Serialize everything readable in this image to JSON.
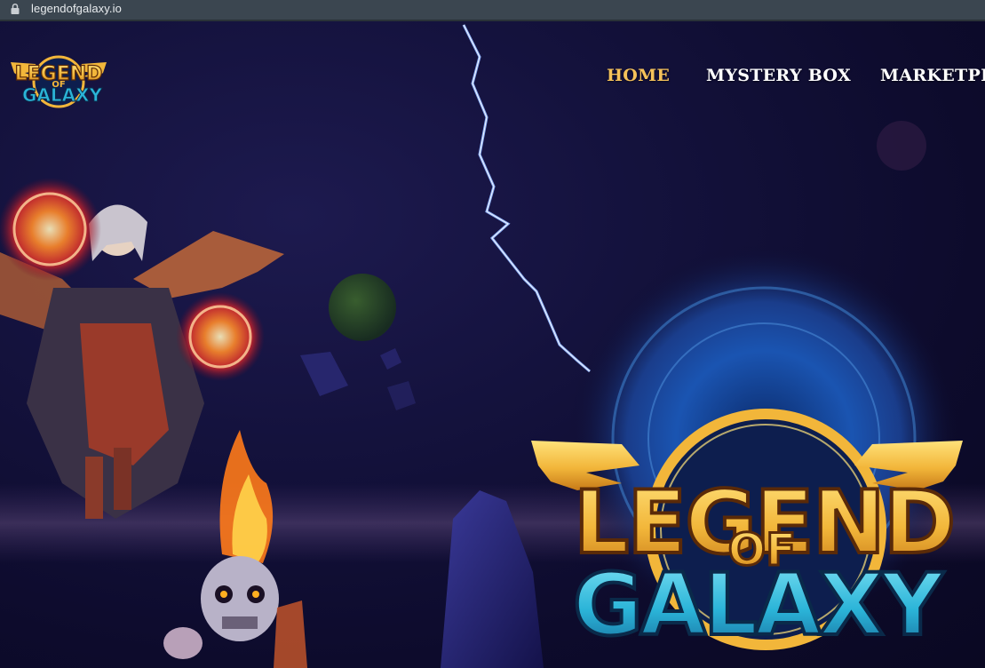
{
  "browser": {
    "url": "legendofgalaxy.io"
  },
  "nav": {
    "items": [
      {
        "label": "HOME",
        "active": true
      },
      {
        "label": "MYSTERY BOX",
        "active": false
      },
      {
        "label": "MARKETPLA",
        "active": false
      }
    ]
  },
  "colors": {
    "nav_active": "#f5c25a",
    "nav_default": "#ffffff",
    "background": "#0d0b2c",
    "logo_gold": "#f2b63a",
    "logo_teal": "#2bb4d8"
  }
}
